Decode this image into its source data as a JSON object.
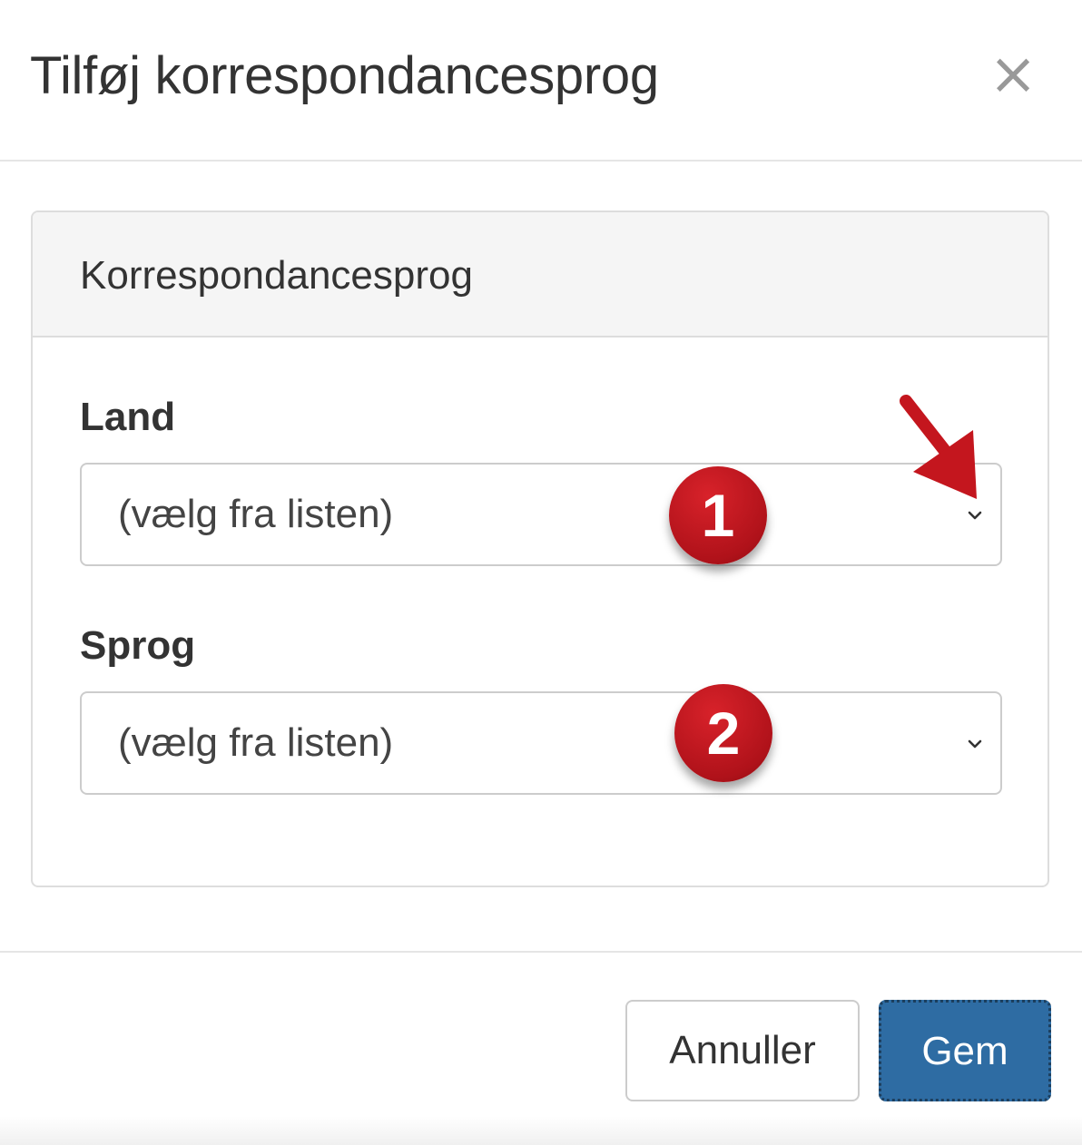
{
  "dialog": {
    "title": "Tilføj korrespondancesprog",
    "close_icon": "close-icon"
  },
  "panel": {
    "heading": "Korrespondancesprog",
    "fields": [
      {
        "label": "Land",
        "value": "(vælg fra listen)"
      },
      {
        "label": "Sprog",
        "value": "(vælg fra listen)"
      }
    ]
  },
  "annotations": {
    "badges": [
      "1",
      "2"
    ],
    "badge_color": "#c4161e",
    "arrow_icon": "red-arrow-icon"
  },
  "footer": {
    "cancel_label": "Annuller",
    "save_label": "Gem",
    "save_color": "#2e6ca3"
  }
}
